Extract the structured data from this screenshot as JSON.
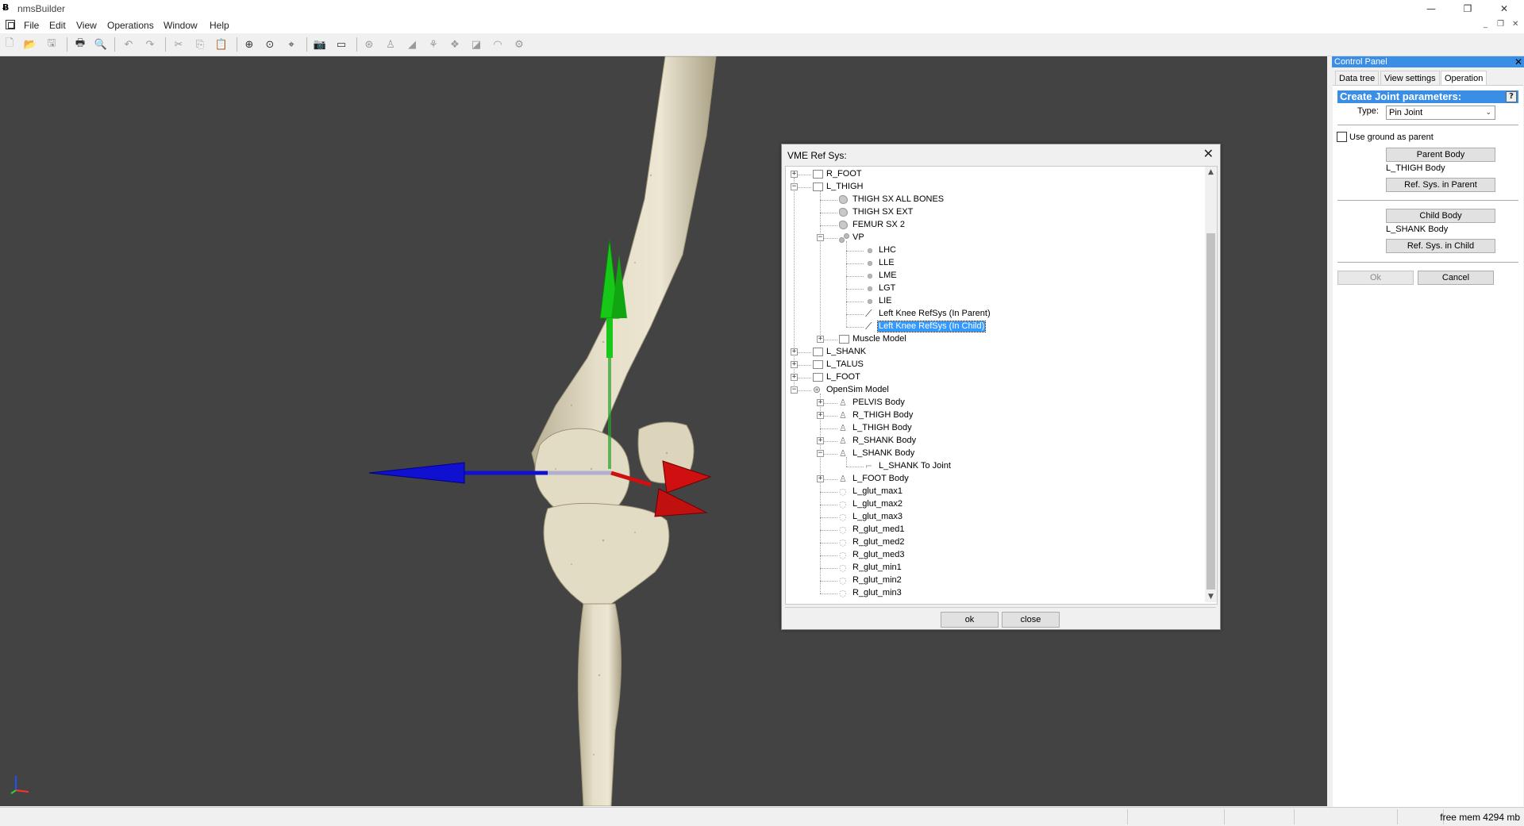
{
  "app": {
    "title": "nmsBuilder",
    "icon": "nmsbuilder-logo-icon"
  },
  "window_controls": {
    "minimize": "—",
    "restore": "❐",
    "close": "✕"
  },
  "menu": {
    "items": [
      "File",
      "Edit",
      "View",
      "Operations",
      "Window",
      "Help"
    ],
    "mdi": {
      "minimize": "_",
      "restore": "❐",
      "close": "✕"
    }
  },
  "toolbar": {
    "buttons": [
      {
        "name": "new-file-icon",
        "glyph": "🗋"
      },
      {
        "name": "open-file-icon",
        "glyph": "📂"
      },
      {
        "name": "save-icon",
        "glyph": "🖫"
      },
      {
        "name": "print-icon",
        "glyph": "🖶"
      },
      {
        "name": "print-preview-icon",
        "glyph": "🔍"
      },
      {
        "name": "undo-icon",
        "glyph": "↶"
      },
      {
        "name": "redo-icon",
        "glyph": "↷"
      },
      {
        "name": "cut-icon",
        "glyph": "✂"
      },
      {
        "name": "copy-icon",
        "glyph": "⎘"
      },
      {
        "name": "paste-icon",
        "glyph": "📋"
      },
      {
        "name": "zoom-all-icon",
        "glyph": "⊕"
      },
      {
        "name": "zoom-selection-icon",
        "glyph": "⊙"
      },
      {
        "name": "center-view-icon",
        "glyph": "⌖"
      },
      {
        "name": "snapshot-icon",
        "glyph": "📷"
      },
      {
        "name": "render-view-icon",
        "glyph": "▭"
      },
      {
        "name": "opensim-icon",
        "glyph": "⊛"
      },
      {
        "name": "body-icon",
        "glyph": "♙"
      },
      {
        "name": "joint-icon",
        "glyph": "◢"
      },
      {
        "name": "muscle-icon",
        "glyph": "⚘"
      },
      {
        "name": "wrap-icon",
        "glyph": "❖"
      },
      {
        "name": "coordinate-icon",
        "glyph": "◪"
      },
      {
        "name": "marker-icon",
        "glyph": "◠"
      },
      {
        "name": "force-icon",
        "glyph": "⚙"
      }
    ]
  },
  "control_panel": {
    "title": "Control Panel",
    "close": "✕",
    "tabs": [
      "Data tree",
      "View settings",
      "Operation"
    ],
    "active_tab": "Operation",
    "header": "Create Joint parameters:",
    "help": "?",
    "type_label": "Type:",
    "type_value": "Pin Joint",
    "use_ground_label": "Use ground as parent",
    "use_ground_checked": false,
    "parent_body_button": "Parent Body",
    "parent_body_value": "L_THIGH Body",
    "ref_sys_parent_button": "Ref. Sys. in Parent",
    "child_body_button": "Child Body",
    "child_body_value": "L_SHANK Body",
    "ref_sys_child_button": "Ref. Sys. in Child",
    "ok_button": "Ok",
    "cancel_button": "Cancel"
  },
  "dialog": {
    "title": "VME Ref Sys:",
    "close": "✕",
    "ok_button": "ok",
    "close_button": "close",
    "tree": [
      {
        "label": "R_FOOT",
        "level": 0,
        "icon": "folder",
        "exp": "+"
      },
      {
        "label": "L_THIGH",
        "level": 0,
        "icon": "folder",
        "exp": "-"
      },
      {
        "label": "THIGH SX ALL BONES",
        "level": 1,
        "icon": "surface"
      },
      {
        "label": "THIGH SX EXT",
        "level": 1,
        "icon": "surface"
      },
      {
        "label": "FEMUR SX 2",
        "level": 1,
        "icon": "surface"
      },
      {
        "label": "VP",
        "level": 1,
        "icon": "pts",
        "exp": "-"
      },
      {
        "label": "LHC",
        "level": 2,
        "icon": "point"
      },
      {
        "label": "LLE",
        "level": 2,
        "icon": "point"
      },
      {
        "label": "LME",
        "level": 2,
        "icon": "point"
      },
      {
        "label": "LGT",
        "level": 2,
        "icon": "point"
      },
      {
        "label": "LIE",
        "level": 2,
        "icon": "point"
      },
      {
        "label": "Left Knee RefSys (In Parent)",
        "level": 2,
        "icon": "refsys"
      },
      {
        "label": "Left Knee RefSys (In Child)",
        "level": 2,
        "icon": "refsys",
        "selected": true
      },
      {
        "label": "Muscle Model",
        "level": 1,
        "icon": "folder",
        "exp": "+"
      },
      {
        "label": "L_SHANK",
        "level": 0,
        "icon": "folder",
        "exp": "+"
      },
      {
        "label": "L_TALUS",
        "level": 0,
        "icon": "folder",
        "exp": "+"
      },
      {
        "label": "L_FOOT",
        "level": 0,
        "icon": "folder",
        "exp": "+"
      },
      {
        "label": "OpenSim Model",
        "level": 0,
        "icon": "model",
        "exp": "-"
      },
      {
        "label": "PELVIS Body",
        "level": 1,
        "icon": "body",
        "exp": "+"
      },
      {
        "label": "R_THIGH Body",
        "level": 1,
        "icon": "body",
        "exp": "+"
      },
      {
        "label": "L_THIGH Body",
        "level": 1,
        "icon": "body"
      },
      {
        "label": "R_SHANK Body",
        "level": 1,
        "icon": "body",
        "exp": "+"
      },
      {
        "label": "L_SHANK Body",
        "level": 1,
        "icon": "body",
        "exp": "-"
      },
      {
        "label": "L_SHANK To  Joint",
        "level": 2,
        "icon": "joint"
      },
      {
        "label": "L_FOOT Body",
        "level": 1,
        "icon": "body",
        "exp": "+"
      },
      {
        "label": "L_glut_max1",
        "level": 1,
        "icon": "muscle"
      },
      {
        "label": "L_glut_max2",
        "level": 1,
        "icon": "muscle"
      },
      {
        "label": "L_glut_max3",
        "level": 1,
        "icon": "muscle"
      },
      {
        "label": "R_glut_med1",
        "level": 1,
        "icon": "muscle"
      },
      {
        "label": "R_glut_med2",
        "level": 1,
        "icon": "muscle"
      },
      {
        "label": "R_glut_med3",
        "level": 1,
        "icon": "muscle"
      },
      {
        "label": "R_glut_min1",
        "level": 1,
        "icon": "muscle"
      },
      {
        "label": "R_glut_min2",
        "level": 1,
        "icon": "muscle"
      },
      {
        "label": "R_glut_min3",
        "level": 1,
        "icon": "muscle"
      }
    ]
  },
  "status": {
    "free_mem": "free mem 4294 mb"
  },
  "colors": {
    "viewport_bg": "#434343",
    "bone": "#e3dcc4",
    "bone_shadow": "#b5ad92",
    "axis_x": "#1010d0",
    "axis_y": "#18c818",
    "axis_z": "#d01010",
    "accent": "#3a8ee6",
    "selection": "#3399ff"
  }
}
